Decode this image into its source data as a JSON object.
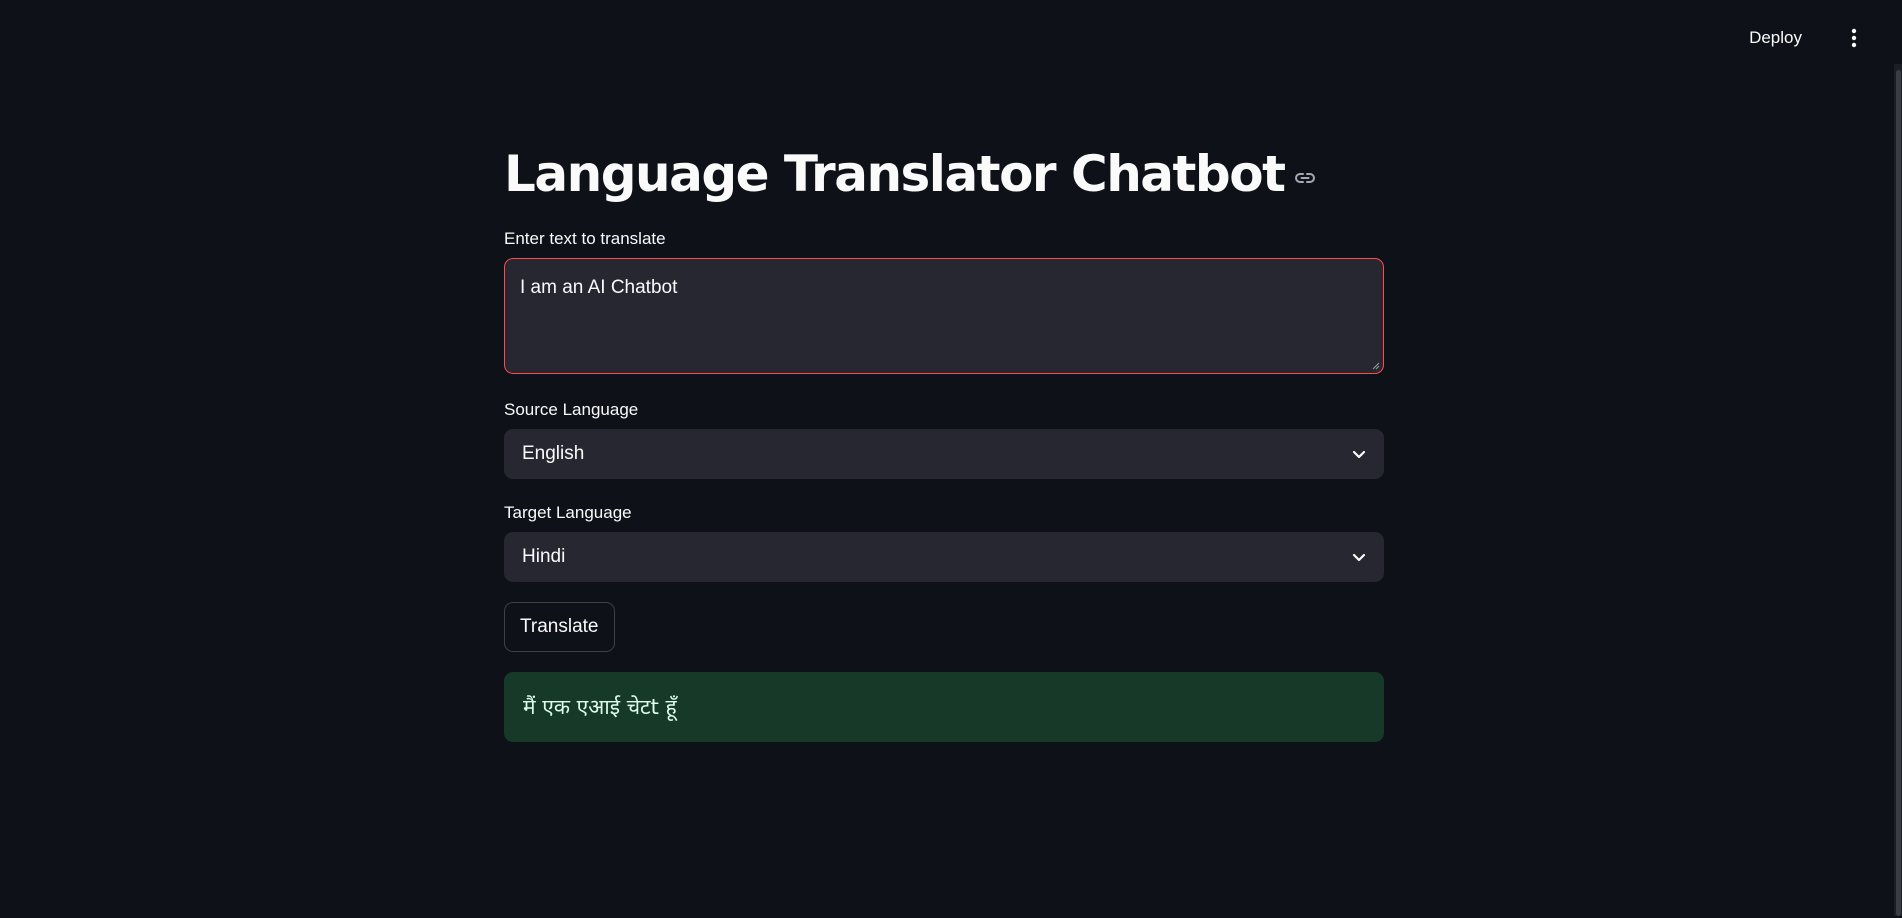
{
  "header": {
    "deploy_label": "Deploy",
    "menu_icon": "vertical-ellipsis-icon"
  },
  "page": {
    "title": "Language Translator Chatbot",
    "anchor_icon": "link-icon"
  },
  "input": {
    "label": "Enter text to translate",
    "value": "I am an AI Chatbot"
  },
  "source_language": {
    "label": "Source Language",
    "selected": "English"
  },
  "target_language": {
    "label": "Target Language",
    "selected": "Hindi"
  },
  "actions": {
    "translate_label": "Translate"
  },
  "result": {
    "text": "मैं एक एआई चेटt हूँ"
  },
  "colors": {
    "background": "#0e1117",
    "input_background": "#262730",
    "focus_border": "#ff4b4b",
    "success_background": "#173928",
    "success_text": "#dffde9"
  }
}
